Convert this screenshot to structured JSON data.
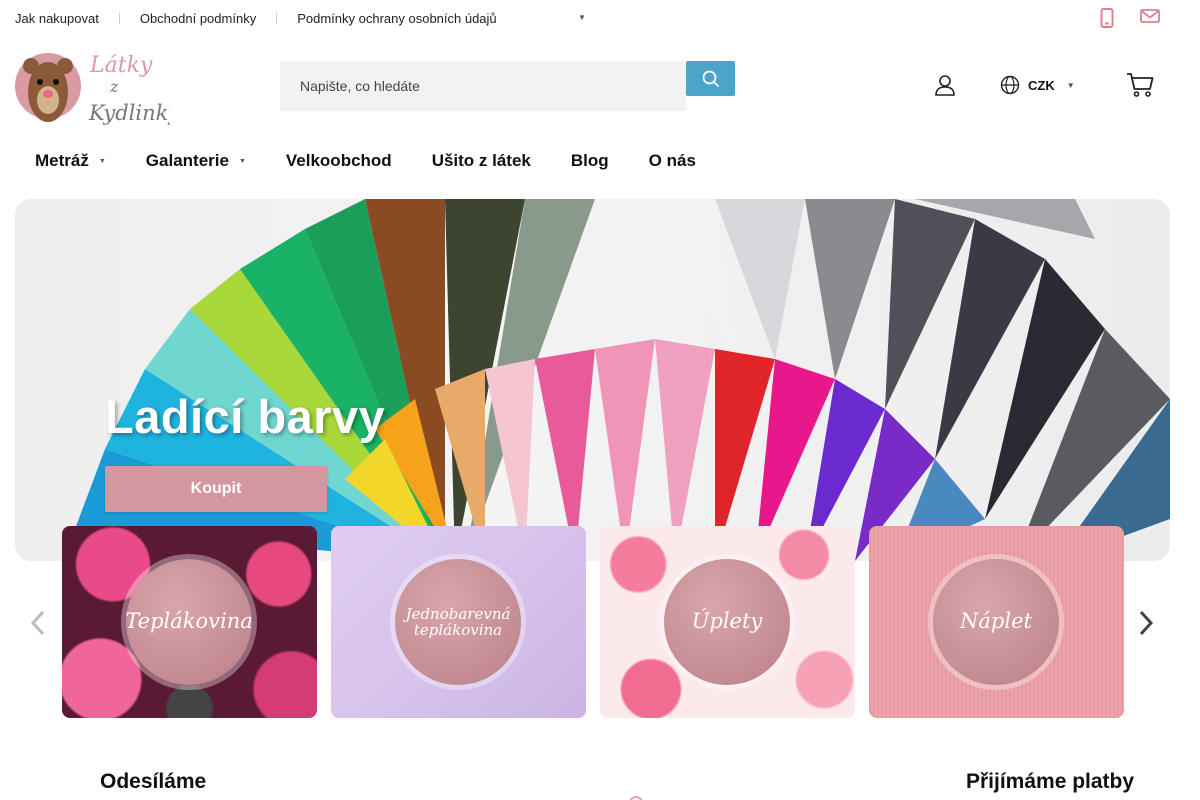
{
  "topbar": {
    "links": [
      "Jak nakupovat",
      "Obchodní podmínky",
      "Podmínky ochrany osobních údajů"
    ],
    "more_icon": "chevron-down-icon",
    "icons": [
      "phone-icon",
      "mail-icon"
    ]
  },
  "logo": {
    "text_line1": "Látky",
    "text_line2": "z",
    "text_line3": "Kydlinky"
  },
  "search": {
    "placeholder": "Napište, co hledáte",
    "button_icon": "search-icon"
  },
  "header": {
    "user_icon": "user-icon",
    "currency_icon": "globe-icon",
    "currency": "CZK",
    "cart_icon": "cart-icon"
  },
  "nav": {
    "items": [
      {
        "label": "Metráž",
        "has_dropdown": true
      },
      {
        "label": "Galanterie",
        "has_dropdown": true
      },
      {
        "label": "Velkoobchod",
        "has_dropdown": false
      },
      {
        "label": "Ušito z látek",
        "has_dropdown": false
      },
      {
        "label": "Blog",
        "has_dropdown": false
      },
      {
        "label": "O nás",
        "has_dropdown": false
      }
    ]
  },
  "hero": {
    "title": "Ladící barvy",
    "button_label": "Koupit"
  },
  "categories": [
    {
      "label": "Teplákovina"
    },
    {
      "label": "Jednobarevná teplákovina"
    },
    {
      "label": "Úplety"
    },
    {
      "label": "Náplet"
    }
  ],
  "bottom": {
    "left_heading": "Odesíláme",
    "right_heading": "Přijímáme platby"
  },
  "colors": {
    "accent_blue": "#4ba5c8",
    "accent_pink": "#d4979f",
    "icon_pink": "#e0808f"
  }
}
